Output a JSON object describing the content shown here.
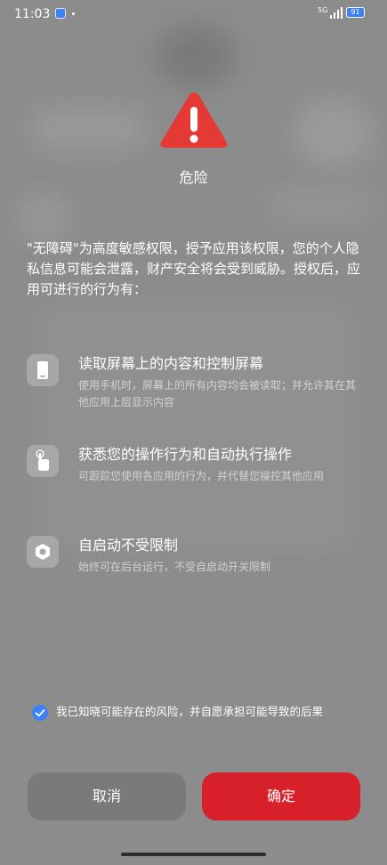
{
  "status_bar": {
    "time": "11:03",
    "network": "5G",
    "battery": "91"
  },
  "dialog": {
    "title": "危险",
    "intro": "\"无障碍\"为高度敏感权限，授予应用该权限，您的个人隐私信息可能会泄露，财产安全将会受到威胁。授权后，应用可进行的行为有：",
    "permissions": [
      {
        "icon": "phone-screen-icon",
        "title": "读取屏幕上的内容和控制屏幕",
        "desc": "使用手机时，屏幕上的所有内容均会被读取；并允许其在其他应用上层显示内容"
      },
      {
        "icon": "touch-gesture-icon",
        "title": "获悉您的操作行为和自动执行操作",
        "desc": "可跟踪您使用各应用的行为，并代替您操控其他应用"
      },
      {
        "icon": "gear-icon",
        "title": "自启动不受限制",
        "desc": "始终可在后台运行，不受自启动开关限制"
      }
    ],
    "consent": {
      "checked": true,
      "text": "我已知晓可能存在的风险，并自愿承担可能导致的后果"
    },
    "buttons": {
      "cancel": "取消",
      "confirm": "确定"
    }
  },
  "colors": {
    "warning_red": "#e53935",
    "confirm_red": "#d7202a",
    "checkbox_blue": "#3b82f6"
  }
}
